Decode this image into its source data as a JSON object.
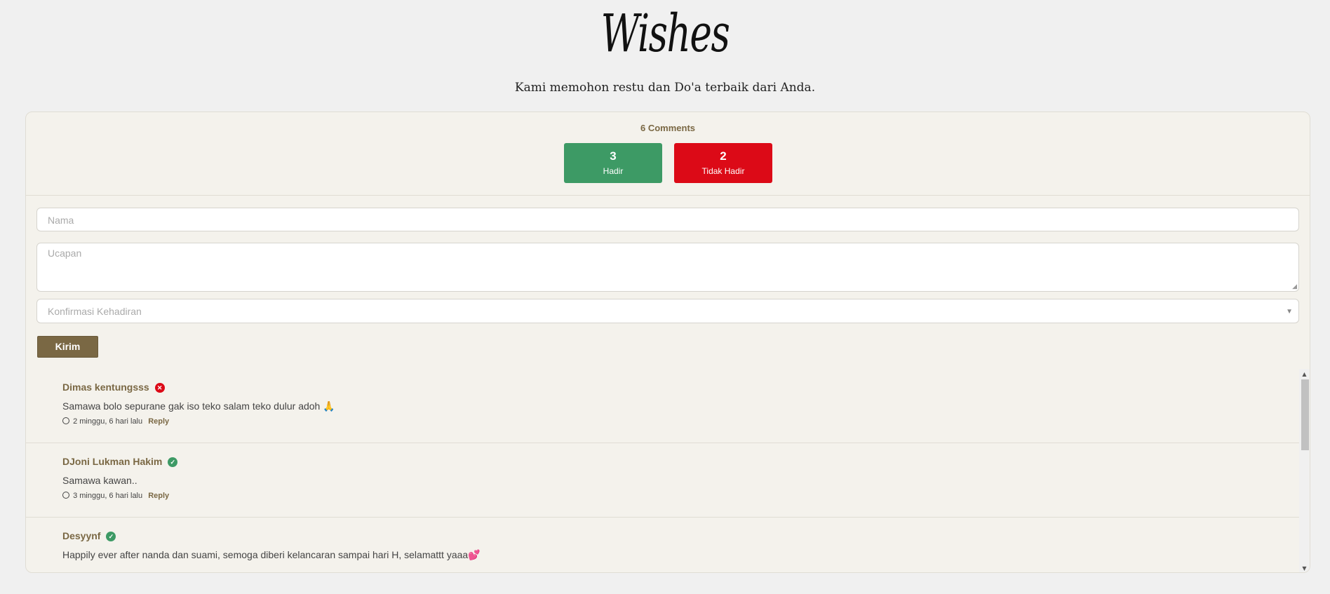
{
  "header": {
    "title": "Wishes",
    "subtitle": "Kami memohon restu dan Do'a terbaik dari Anda."
  },
  "summary": {
    "comments_label": "6 Comments",
    "hadir": {
      "count": "3",
      "label": "Hadir"
    },
    "tidak_hadir": {
      "count": "2",
      "label": "Tidak Hadir"
    }
  },
  "form": {
    "nama_placeholder": "Nama",
    "ucapan_placeholder": "Ucapan",
    "konfirmasi_placeholder": "Konfirmasi Kehadiran",
    "submit_label": "Kirim"
  },
  "comments": [
    {
      "name": "Dimas kentungsss",
      "status": "no",
      "text": "Samawa bolo sepurane gak iso teko salam teko dulur adoh 🙏",
      "time": "2 minggu, 6 hari lalu",
      "reply": "Reply"
    },
    {
      "name": "DJoni Lukman Hakim",
      "status": "yes",
      "text": "Samawa kawan..",
      "time": "3 minggu, 6 hari lalu",
      "reply": "Reply"
    },
    {
      "name": "Desyynf",
      "status": "yes",
      "text": "Happily ever after nanda dan suami, semoga diberi kelancaran sampai hari H, selamattt yaaa💕",
      "time": "",
      "reply": ""
    }
  ],
  "colors": {
    "accent": "#7a6844",
    "hadir": "#3d9a65",
    "tidak_hadir": "#dc0a17"
  }
}
